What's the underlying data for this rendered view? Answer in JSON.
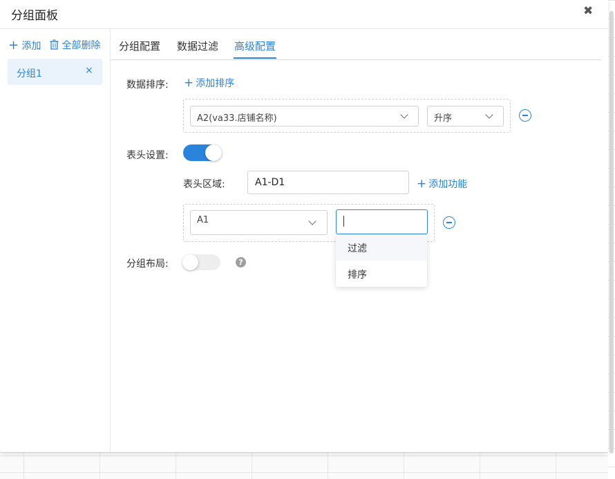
{
  "dialog": {
    "title": "分组面板",
    "close_label": "✖"
  },
  "sidebar": {
    "add_label": "添加",
    "delete_all_label": "全部删除",
    "groups": [
      {
        "label": "分组1",
        "remove_label": "×"
      }
    ]
  },
  "tabs": [
    {
      "label": "分组配置",
      "active": false
    },
    {
      "label": "数据过滤",
      "active": false
    },
    {
      "label": "高级配置",
      "active": true
    }
  ],
  "sort": {
    "label": "数据排序:",
    "add_label": "添加排序",
    "field_value": "A2(va33.店铺名称)",
    "order_value": "升序"
  },
  "header_settings": {
    "label": "表头设置:",
    "enabled": true,
    "area_label": "表头区域:",
    "area_value": "A1-D1",
    "add_function_label": "添加功能",
    "cell_value": "A1",
    "function_value": "",
    "function_options": [
      "过滤",
      "排序"
    ]
  },
  "group_layout": {
    "label": "分组布局:",
    "enabled": false,
    "help": "?"
  },
  "colors": {
    "accent": "#2b84dc",
    "active_bg": "#eaf3fc"
  }
}
